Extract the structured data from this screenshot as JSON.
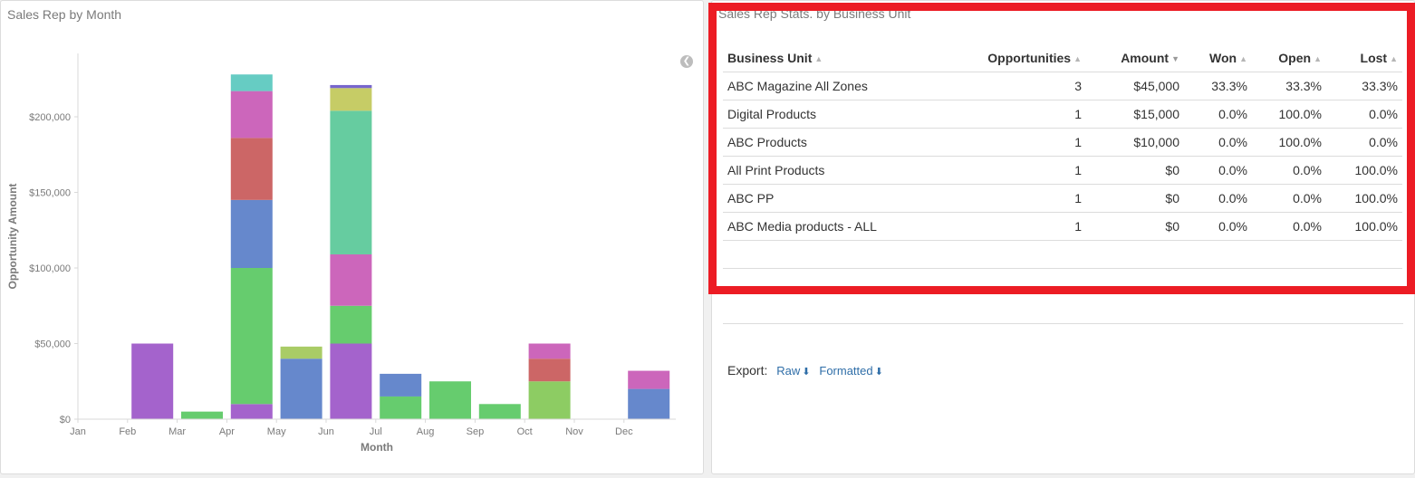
{
  "left_panel": {
    "title": "Sales Rep by Month"
  },
  "right_panel": {
    "title": "Sales Rep Stats. by Business Unit"
  },
  "chart_data": {
    "type": "bar",
    "stacked": true,
    "xlabel": "Month",
    "ylabel": "Opportunity Amount",
    "categories": [
      "Jan",
      "Feb",
      "Mar",
      "Apr",
      "May",
      "Jun",
      "Jul",
      "Aug",
      "Sep",
      "Oct",
      "Nov",
      "Dec"
    ],
    "yticks": [
      "$0",
      "$50,000",
      "$100,000",
      "$150,000",
      "$200,000"
    ],
    "ylim": [
      0,
      240000
    ],
    "series": [
      {
        "color": "#a463cc",
        "values": [
          0,
          50000,
          0,
          10000,
          0,
          50000,
          0,
          0,
          0,
          0,
          0,
          0
        ]
      },
      {
        "color": "#66cc6e",
        "values": [
          0,
          0,
          5000,
          90000,
          0,
          25000,
          15000,
          25000,
          10000,
          0,
          0,
          0
        ]
      },
      {
        "color": "#8dcc63",
        "values": [
          0,
          0,
          0,
          0,
          0,
          0,
          0,
          0,
          0,
          25000,
          0,
          0
        ]
      },
      {
        "color": "#6688cc",
        "values": [
          0,
          0,
          0,
          45000,
          40000,
          0,
          15000,
          0,
          0,
          0,
          0,
          20000
        ]
      },
      {
        "color": "#cc6666",
        "values": [
          0,
          0,
          0,
          41000,
          0,
          0,
          0,
          0,
          0,
          15000,
          0,
          0
        ]
      },
      {
        "color": "#cc66bb",
        "values": [
          0,
          0,
          0,
          31000,
          0,
          34000,
          0,
          0,
          0,
          10000,
          0,
          12000
        ]
      },
      {
        "color": "#66cca0",
        "values": [
          0,
          0,
          0,
          0,
          0,
          95000,
          0,
          0,
          0,
          0,
          0,
          0
        ]
      },
      {
        "color": "#a9cc66",
        "values": [
          0,
          0,
          0,
          0,
          8000,
          0,
          0,
          0,
          0,
          0,
          0,
          0
        ]
      },
      {
        "color": "#c6cc66",
        "values": [
          0,
          0,
          0,
          0,
          0,
          15000,
          0,
          0,
          0,
          0,
          0,
          0
        ]
      },
      {
        "color": "#66ccc3",
        "values": [
          0,
          0,
          0,
          11000,
          0,
          0,
          0,
          0,
          0,
          0,
          0,
          0
        ]
      },
      {
        "color": "#7766cc",
        "values": [
          0,
          0,
          0,
          0,
          0,
          2000,
          0,
          0,
          0,
          0,
          0,
          0
        ]
      }
    ]
  },
  "table": {
    "columns": [
      "Business Unit",
      "Opportunities",
      "Amount",
      "Won",
      "Open",
      "Lost"
    ],
    "sorted_column": "Amount",
    "rows": [
      [
        "ABC Magazine All Zones",
        "3",
        "$45,000",
        "33.3%",
        "33.3%",
        "33.3%"
      ],
      [
        "Digital Products",
        "1",
        "$15,000",
        "0.0%",
        "100.0%",
        "0.0%"
      ],
      [
        "ABC Products",
        "1",
        "$10,000",
        "0.0%",
        "100.0%",
        "0.0%"
      ],
      [
        "All Print Products",
        "1",
        "$0",
        "0.0%",
        "0.0%",
        "100.0%"
      ],
      [
        "ABC PP",
        "1",
        "$0",
        "0.0%",
        "0.0%",
        "100.0%"
      ],
      [
        "ABC Media products - ALL",
        "1",
        "$0",
        "0.0%",
        "0.0%",
        "100.0%"
      ]
    ]
  },
  "export": {
    "label": "Export:",
    "raw": "Raw",
    "formatted": "Formatted"
  },
  "icons": {
    "collapse": "chevron-left-circle-icon",
    "download": "download-icon",
    "sort": "sort-icon"
  },
  "colors": {
    "highlight": "#ec1c24",
    "link": "#2f6ea8"
  }
}
